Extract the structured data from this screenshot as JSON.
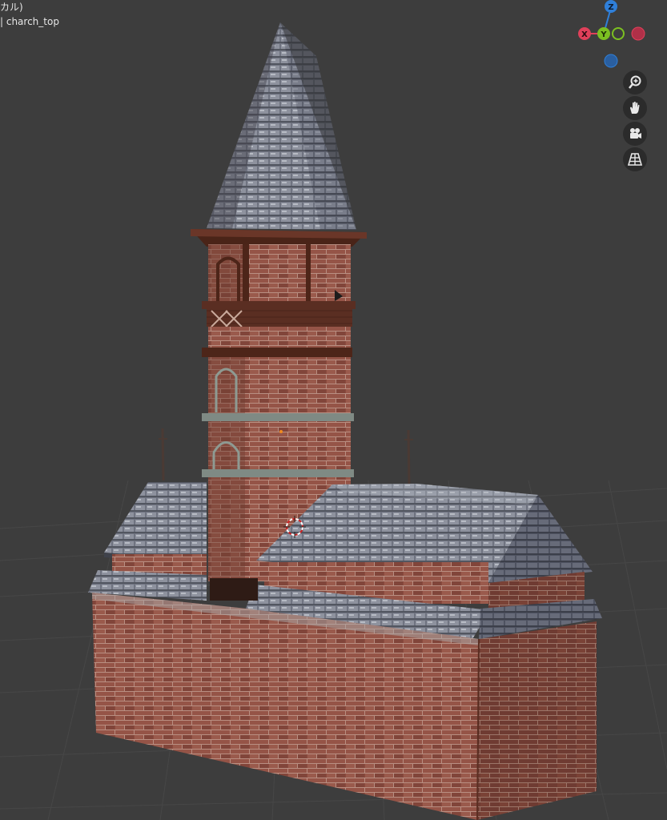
{
  "viewport": {
    "view_mode_label": "カル)",
    "object_info": "| charch_top"
  },
  "gizmo": {
    "z_label": "Z",
    "x_label": "X",
    "y_label": "Y",
    "colors": {
      "x": "#e0405a",
      "y": "#7cc021",
      "z": "#2f7fd9"
    }
  },
  "nav_buttons": [
    {
      "icon": "zoom-icon"
    },
    {
      "icon": "hand-pan-icon"
    },
    {
      "icon": "camera-icon"
    },
    {
      "icon": "perspective-grid-icon"
    }
  ]
}
